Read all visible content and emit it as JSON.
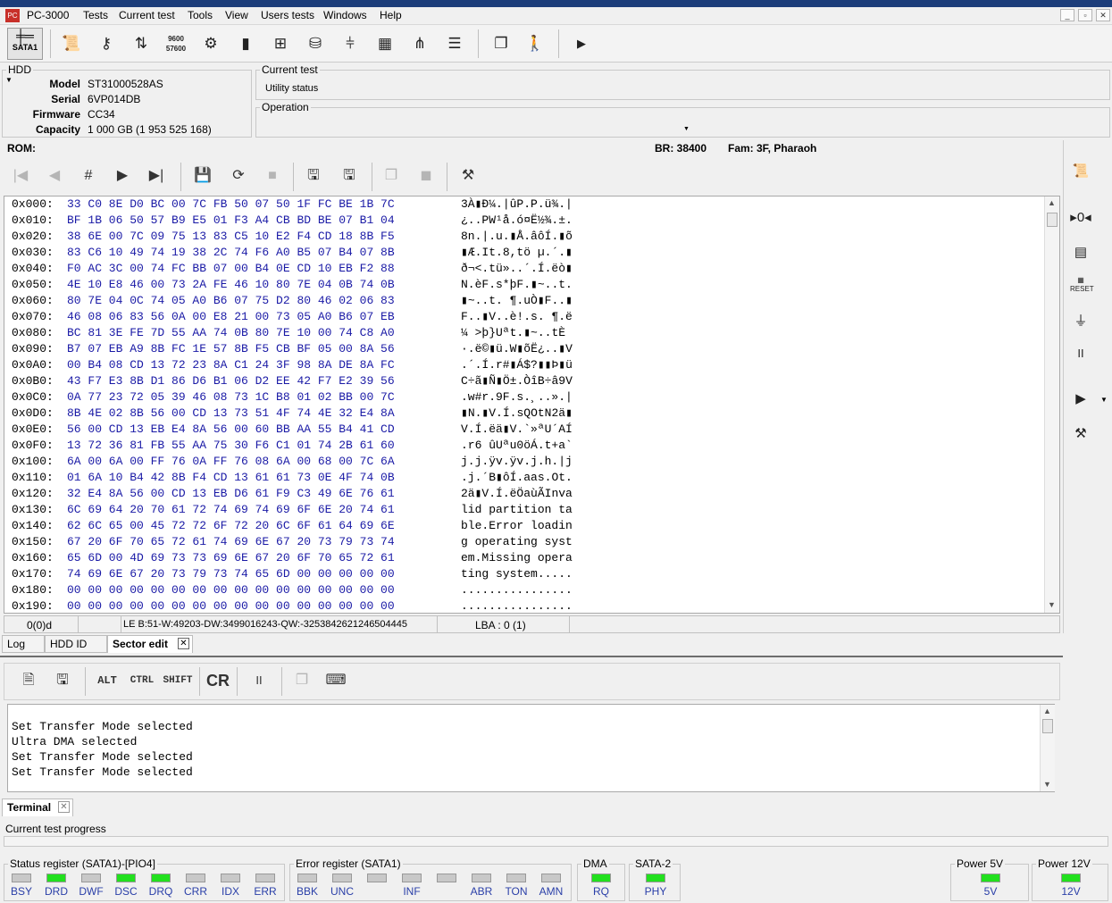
{
  "app": {
    "title": "PC-3000",
    "icon_label": "PC"
  },
  "menu": [
    "Tests",
    "Current test",
    "Tools",
    "View",
    "Users tests",
    "Windows",
    "Help"
  ],
  "window_buttons": [
    "_",
    "▫",
    "✕"
  ],
  "toolbar": {
    "sata_label": "SATA1",
    "speed_label_top": "9600",
    "speed_label_bottom": "57600"
  },
  "hdd": {
    "legend": "HDD",
    "labels": [
      "Model",
      "Serial",
      "Firmware",
      "Capacity"
    ],
    "values": [
      "ST31000528AS",
      "6VP014DB",
      "CC34",
      "1 000 GB (1 953 525 168)"
    ]
  },
  "current_test": {
    "legend": "Current test",
    "value": "Utility status"
  },
  "operation": {
    "legend": "Operation",
    "value": ""
  },
  "rom_bar": {
    "rom": "ROM:",
    "br": "BR: 38400",
    "fam": "Fam: 3F, Pharaoh"
  },
  "hex_rows": [
    {
      "addr": "0x000:",
      "bytes": "33 C0 8E D0 BC 00 7C FB 50 07 50 1F FC BE 1B 7C",
      "ascii": "3À▮Ð¼.|ûP.P.ü¾.|"
    },
    {
      "addr": "0x010:",
      "bytes": "BF 1B 06 50 57 B9 E5 01 F3 A4 CB BD BE 07 B1 04",
      "ascii": "¿..PW¹å.ó¤Ë½¾.±."
    },
    {
      "addr": "0x020:",
      "bytes": "38 6E 00 7C 09 75 13 83 C5 10 E2 F4 CD 18 8B F5",
      "ascii": "8n.|.u.▮Å.âôÍ.▮õ"
    },
    {
      "addr": "0x030:",
      "bytes": "83 C6 10 49 74 19 38 2C 74 F6 A0 B5 07 B4 07 8B",
      "ascii": "▮Æ.It.8,tö µ.´.▮"
    },
    {
      "addr": "0x040:",
      "bytes": "F0 AC 3C 00 74 FC BB 07 00 B4 0E CD 10 EB F2 88",
      "ascii": "ð¬<.tü»..´.Í.ëò▮"
    },
    {
      "addr": "0x050:",
      "bytes": "4E 10 E8 46 00 73 2A FE 46 10 80 7E 04 0B 74 0B",
      "ascii": "N.èF.s*þF.▮~..t."
    },
    {
      "addr": "0x060:",
      "bytes": "80 7E 04 0C 74 05 A0 B6 07 75 D2 80 46 02 06 83",
      "ascii": "▮~..t. ¶.uÒ▮F..▮"
    },
    {
      "addr": "0x070:",
      "bytes": "46 08 06 83 56 0A 00 E8 21 00 73 05 A0 B6 07 EB",
      "ascii": "F..▮V..è!.s. ¶.ë"
    },
    {
      "addr": "0x080:",
      "bytes": "BC 81 3E FE 7D 55 AA 74 0B 80 7E 10 00 74 C8 A0",
      "ascii": "¼ >þ}Uªt.▮~..tÈ"
    },
    {
      "addr": "0x090:",
      "bytes": "B7 07 EB A9 8B FC 1E 57 8B F5 CB BF 05 00 8A 56",
      "ascii": "·.ë©▮ü.W▮õË¿..▮V"
    },
    {
      "addr": "0x0A0:",
      "bytes": "00 B4 08 CD 13 72 23 8A C1 24 3F 98 8A DE 8A FC",
      "ascii": ".´.Í.r#▮Á$?▮▮Þ▮ü"
    },
    {
      "addr": "0x0B0:",
      "bytes": "43 F7 E3 8B D1 86 D6 B1 06 D2 EE 42 F7 E2 39 56",
      "ascii": "C÷ã▮Ñ▮Ö±.ÒîB÷â9V"
    },
    {
      "addr": "0x0C0:",
      "bytes": "0A 77 23 72 05 39 46 08 73 1C B8 01 02 BB 00 7C",
      "ascii": ".w#r.9F.s.¸..».|"
    },
    {
      "addr": "0x0D0:",
      "bytes": "8B 4E 02 8B 56 00 CD 13 73 51 4F 74 4E 32 E4 8A",
      "ascii": "▮N.▮V.Í.sQOtN2ä▮"
    },
    {
      "addr": "0x0E0:",
      "bytes": "56 00 CD 13 EB E4 8A 56 00 60 BB AA 55 B4 41 CD",
      "ascii": "V.Í.ëä▮V.`»ªU´AÍ"
    },
    {
      "addr": "0x0F0:",
      "bytes": "13 72 36 81 FB 55 AA 75 30 F6 C1 01 74 2B 61 60",
      "ascii": ".r6 ûUªu0öÁ.t+a`"
    },
    {
      "addr": "0x100:",
      "bytes": "6A 00 6A 00 FF 76 0A FF 76 08 6A 00 68 00 7C 6A",
      "ascii": "j.j.ÿv.ÿv.j.h.|j"
    },
    {
      "addr": "0x110:",
      "bytes": "01 6A 10 B4 42 8B F4 CD 13 61 61 73 0E 4F 74 0B",
      "ascii": ".j.´B▮ôÍ.aas.Ot."
    },
    {
      "addr": "0x120:",
      "bytes": "32 E4 8A 56 00 CD 13 EB D6 61 F9 C3 49 6E 76 61",
      "ascii": "2ä▮V.Í.ëÖaùÃInva"
    },
    {
      "addr": "0x130:",
      "bytes": "6C 69 64 20 70 61 72 74 69 74 69 6F 6E 20 74 61",
      "ascii": "lid partition ta"
    },
    {
      "addr": "0x140:",
      "bytes": "62 6C 65 00 45 72 72 6F 72 20 6C 6F 61 64 69 6E",
      "ascii": "ble.Error loadin"
    },
    {
      "addr": "0x150:",
      "bytes": "67 20 6F 70 65 72 61 74 69 6E 67 20 73 79 73 74",
      "ascii": "g operating syst"
    },
    {
      "addr": "0x160:",
      "bytes": "65 6D 00 4D 69 73 73 69 6E 67 20 6F 70 65 72 61",
      "ascii": "em.Missing opera"
    },
    {
      "addr": "0x170:",
      "bytes": "74 69 6E 67 20 73 79 73 74 65 6D 00 00 00 00 00",
      "ascii": "ting system....."
    },
    {
      "addr": "0x180:",
      "bytes": "00 00 00 00 00 00 00 00 00 00 00 00 00 00 00 00",
      "ascii": "................"
    },
    {
      "addr": "0x190:",
      "bytes": "00 00 00 00 00 00 00 00 00 00 00 00 00 00 00 00",
      "ascii": "................"
    }
  ],
  "hex_status": {
    "offset": "0(0)d",
    "values": "LE B:51-W:49203-DW:3499016243-QW:-3253842621246504445",
    "lba": "LBA : 0 (1)"
  },
  "tabs": [
    "Log",
    "HDD ID",
    "Sector edit"
  ],
  "terminal_toolbar": {
    "alt": "ALT",
    "ctrl": "CTRL",
    "shift": "SHIFT",
    "cr": "CR",
    "pause": "II"
  },
  "terminal_lines": [
    "Set Transfer Mode selected",
    "Ultra DMA selected",
    "Set Transfer Mode selected",
    "Set Transfer Mode selected"
  ],
  "terminal_tab": "Terminal",
  "progress": {
    "label": "Current test progress",
    "fraction": 0
  },
  "status_register": {
    "legend": "Status register (SATA1)-[PIO4]",
    "leds": [
      {
        "name": "BSY",
        "on": false
      },
      {
        "name": "DRD",
        "on": true
      },
      {
        "name": "DWF",
        "on": false
      },
      {
        "name": "DSC",
        "on": true
      },
      {
        "name": "DRQ",
        "on": true
      },
      {
        "name": "CRR",
        "on": false
      },
      {
        "name": "IDX",
        "on": false
      },
      {
        "name": "ERR",
        "on": false
      }
    ]
  },
  "error_register": {
    "legend": "Error register (SATA1)",
    "leds": [
      {
        "name": "BBK",
        "on": false
      },
      {
        "name": "UNC",
        "on": false
      },
      {
        "name": "",
        "on": false
      },
      {
        "name": "INF",
        "on": false
      },
      {
        "name": "",
        "on": false
      },
      {
        "name": "ABR",
        "on": false
      },
      {
        "name": "TON",
        "on": false
      },
      {
        "name": "AMN",
        "on": false
      }
    ]
  },
  "dma": {
    "legend": "DMA",
    "led": "RQ",
    "on": true
  },
  "sata2": {
    "legend": "SATA-2",
    "led": "PHY",
    "on": true
  },
  "power5": {
    "legend": "Power 5V",
    "led": "5V",
    "on": true
  },
  "power12": {
    "legend": "Power 12V",
    "led": "12V",
    "on": true
  },
  "colors": {
    "led_on": "#22e01e",
    "led_off": "#c8c8c8",
    "hex_bytes": "#1a1aa6",
    "led_label": "#2a3fa8"
  }
}
